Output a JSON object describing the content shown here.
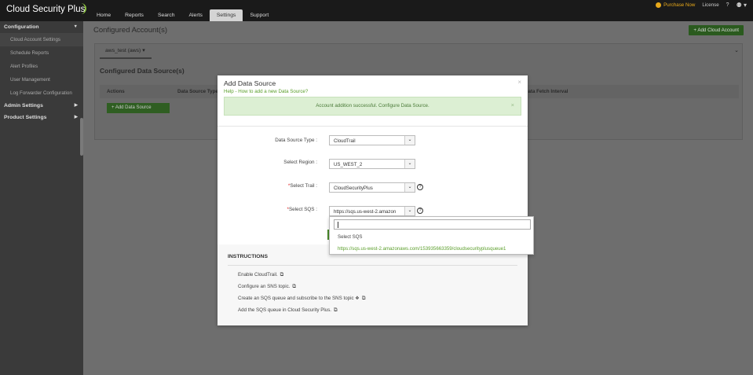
{
  "app": {
    "logo_text": "Cloud Security Plus",
    "nav_tabs": [
      "Home",
      "Reports",
      "Search",
      "Alerts",
      "Settings",
      "Support"
    ],
    "active_tab": "Settings",
    "purchase_label": "Purchase Now",
    "license_label": "License",
    "help_label": "?",
    "user_label": "⚉ ▾"
  },
  "sidebar": {
    "configuration": {
      "label": "Configuration",
      "arrow": "▼"
    },
    "items": [
      "Cloud Account Settings",
      "Schedule Reports",
      "Alert Profiles",
      "User Management",
      "Log Forwarder Configuration"
    ],
    "admin_settings": {
      "label": "Admin Settings",
      "arrow": "▶"
    },
    "product_settings": {
      "label": "Product Settings",
      "arrow": "▶"
    }
  },
  "main": {
    "title": "Configured Account(s)",
    "add_account_button": "+ Add Cloud Account",
    "account_tab": "aws_test (aws) ▾",
    "panel_chevron": "⌄",
    "section_title": "Configured Data Source(s)",
    "columns": [
      "Actions",
      "Data Source Type",
      "Data Fetch Interval"
    ],
    "add_data_source_button": "+ Add Data Source"
  },
  "modal": {
    "title": "Add Data Source",
    "help_link": "Help - How to add a new Data Source?",
    "close": "×",
    "success_message": "Account addition successful. Configure Data Source.",
    "success_close": "×",
    "fields": {
      "data_source_type": {
        "label": "Data Source Type :",
        "value": "CloudTrail"
      },
      "region": {
        "label": "Select Region :",
        "value": "US_WEST_2"
      },
      "trail": {
        "required": "*",
        "label": "Select Trail :",
        "value": "CloudSecurityPlus"
      },
      "sqs": {
        "required": "*",
        "label": "Select SQS :",
        "value": "https://sqs.us-west-2.amazon"
      }
    },
    "help_icon": "?",
    "dropdown_arrow": "⌄",
    "instructions": {
      "title": "INSTRUCTIONS",
      "items": [
        "Enable CloudTrail.",
        "Configure an SNS topic.",
        "Create an SQS queue and subscribe to the SNS topic ❖",
        "Add the SQS queue in Cloud Security Plus."
      ],
      "ext_icon": "⧉"
    }
  },
  "sqs_dropdown": {
    "search_value": "",
    "options": [
      "Select SQS",
      "https://sqs.us-west-2.amazonaws.com/153935663359/cloudsecurityplusqueue1"
    ]
  },
  "colors": {
    "accent_green": "#5a9e2a",
    "success_bg": "#dcefd3",
    "purchase_orange": "#e8a91a",
    "topbar_bg": "#1a1a1a"
  }
}
